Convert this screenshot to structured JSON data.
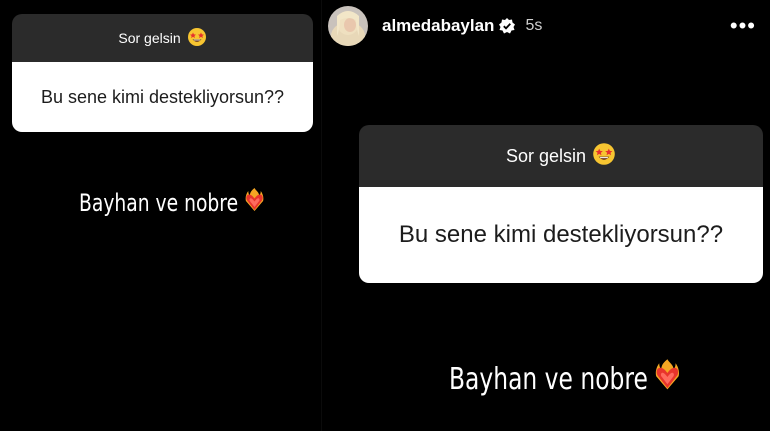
{
  "story": {
    "username": "almedabaylan",
    "timestamp": "5s",
    "more_label": "•••",
    "verified": true
  },
  "panels": [
    {
      "question_header": "Sor gelsin",
      "question_emoji": "star-struck-face-icon",
      "question_text": "Bu sene kimi destekliyorsun??",
      "answer_text": "Bayhan ve nobre",
      "answer_emoji": "heart-on-fire-icon"
    },
    {
      "question_header": "Sor gelsin",
      "question_emoji": "star-struck-face-icon",
      "question_text": "Bu sene kimi destekliyorsun??",
      "answer_text": "Bayhan ve nobre",
      "answer_emoji": "heart-on-fire-icon"
    }
  ],
  "colors": {
    "background": "#000000",
    "question_header_bg": "#2b2b2b",
    "question_body_bg": "#ffffff",
    "text_light": "#ffffff",
    "text_dark": "#1c1c1c"
  }
}
